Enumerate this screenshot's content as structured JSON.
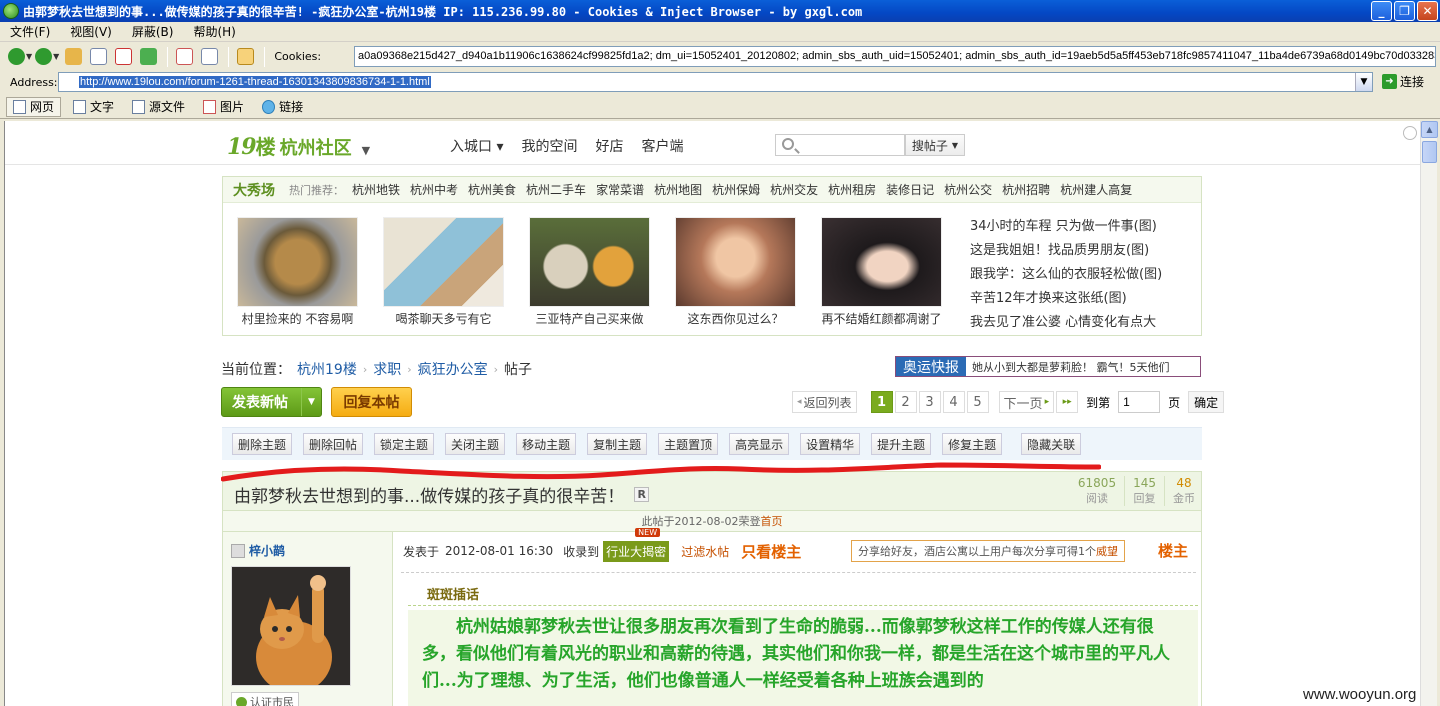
{
  "window": {
    "title": "由郭梦秋去世想到的事...做传媒的孩子真的很辛苦! -疯狂办公室-杭州19楼  IP: 115.236.99.80 - Cookies & Inject Browser - by gxgl.com",
    "buttons": {
      "minimize": "_",
      "restore": "❐",
      "close": "✕"
    }
  },
  "menu": [
    "文件(F)",
    "视图(V)",
    "屏蔽(B)",
    "帮助(H)"
  ],
  "toolbar": {
    "cookies_label": "Cookies:",
    "cookies_value": "a0a09368e215d427_d940a1b11906c1638624cf99825fd1a2; dm_ui=15052401_20120802; admin_sbs_auth_uid=15052401; admin_sbs_auth_id=19aeb5d5a5ff453eb718fc9857411047_11ba4de6739a68d0149bc70d033283eb"
  },
  "address": {
    "label": "Address:",
    "url": "http://www.19lou.com/forum-1261-thread-16301343809836734-1-1.html",
    "go_label": "连接"
  },
  "view_tabs": [
    "网页",
    "文字",
    "源文件",
    "图片",
    "链接"
  ],
  "site": {
    "logo_19": "19",
    "logo_lou": "楼",
    "logo_city": "杭州社区",
    "nav": [
      "入城口 ▾",
      "我的空间",
      "好店",
      "客户端"
    ],
    "search_button": "搜帖子"
  },
  "show": {
    "title": "大秀场",
    "hot_label": "热门推荐：",
    "tags": [
      "杭州地铁",
      "杭州中考",
      "杭州美食",
      "杭州二手车",
      "家常菜谱",
      "杭州地图",
      "杭州保姆",
      "杭州交友",
      "杭州租房",
      "装修日记",
      "杭州公交",
      "杭州招聘",
      "杭州建人高复"
    ],
    "thumbs": [
      {
        "caption": "村里捡来的 不容易啊"
      },
      {
        "caption": "喝茶聊天多亏有它"
      },
      {
        "caption": "三亚特产自己买来做"
      },
      {
        "caption": "这东西你见过么？"
      },
      {
        "caption": "再不结婚红颜都凋谢了"
      }
    ],
    "side_links": [
      "34小时的车程 只为做一件事(图)",
      "这是我姐姐！找品质男朋友(图)",
      "跟我学：这么仙的衣服轻松做(图)",
      "辛苦12年才换来这张纸(图)",
      "我去见了准公婆 心情变化有点大"
    ]
  },
  "breadcrumb": {
    "prefix": "当前位置：",
    "items": [
      "杭州19楼",
      "求职",
      "疯狂办公室"
    ],
    "current": "帖子"
  },
  "olympic": {
    "tag": "奥运快报",
    "text": "她从小到大都是萝莉脸！ 霸气！5天他们"
  },
  "actions": {
    "new_post": "发表新帖",
    "reply": "回复本帖"
  },
  "pager": {
    "back": "返回列表",
    "pages": [
      "1",
      "2",
      "3",
      "4",
      "5"
    ],
    "current": "1",
    "next": "下一页",
    "goto_label": "到第",
    "goto_value": "1",
    "page_unit": "页",
    "ok": "确定"
  },
  "admin_buttons": [
    "删除主题",
    "删除回帖",
    "锁定主题",
    "关闭主题",
    "移动主题",
    "复制主题",
    "主题置顶",
    "高亮显示",
    "设置精华",
    "提升主题",
    "修复主题",
    "隐藏关联"
  ],
  "thread": {
    "title": "由郭梦秋去世想到的事...做传媒的孩子真的很辛苦！",
    "r_badge": "R",
    "stats": [
      {
        "value": "61805",
        "label": "阅读"
      },
      {
        "value": "145",
        "label": "回复"
      },
      {
        "value": "48",
        "label": "金币"
      }
    ],
    "sub_text": "此帖于2012-08-02荣登",
    "sub_link": "首页"
  },
  "post": {
    "author": "梓小鹋",
    "verify": "认证市民",
    "posted_label": "发表于",
    "posted_time": "2012-08-01 16:30",
    "collected_label": "收录到",
    "industry_tag": "行业大揭密",
    "new_badge": "NEW",
    "filter_link": "过滤水帖",
    "only_op": "只看楼主",
    "share_text": "分享给好友，酒店公寓以上用户每次分享可得1个",
    "share_coin": "威望",
    "floor": "楼主",
    "section": "斑斑插话",
    "content": "杭州姑娘郭梦秋去世让很多朋友再次看到了生命的脆弱...而像郭梦秋这样工作的传媒人还有很多，看似他们有着风光的职业和高薪的待遇，其实他们和你我一样，都是生活在这个城市里的平凡人们...为了理想、为了生活，他们也像普通人一样经受着各种上班族会遇到的"
  },
  "watermark": "www.wooyun.org"
}
